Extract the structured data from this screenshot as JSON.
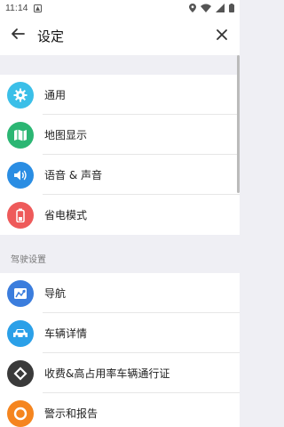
{
  "status_bar": {
    "time": "11:14"
  },
  "app_bar": {
    "title": "设定"
  },
  "general_items": [
    {
      "label": "通用",
      "icon": "gear-icon",
      "color": "#3bbfe8"
    },
    {
      "label": "地图显示",
      "icon": "map-icon",
      "color": "#2bb673"
    },
    {
      "label": "语音 & 声音",
      "icon": "speaker-icon",
      "color": "#2a8de3"
    },
    {
      "label": "省电模式",
      "icon": "battery-icon",
      "color": "#ee5a5a"
    }
  ],
  "driving_section": {
    "title": "驾驶设置",
    "items": [
      {
        "label": "导航",
        "icon": "navigation-icon",
        "color": "#3b7ddd"
      },
      {
        "label": "车辆详情",
        "icon": "car-icon",
        "color": "#2ba0e8"
      },
      {
        "label": "收费&高占用率车辆通行证",
        "icon": "toll-icon",
        "color": "#3a3a3a"
      },
      {
        "label": "警示和报告",
        "icon": "alert-icon",
        "color": "#f5851f"
      }
    ]
  }
}
